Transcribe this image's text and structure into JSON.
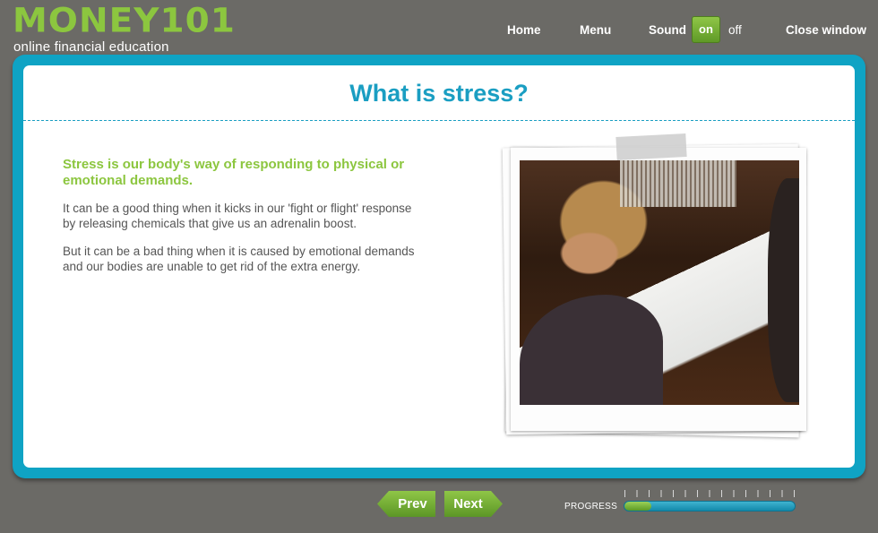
{
  "logo": {
    "brand": "MONEY101",
    "tagline": "online financial education"
  },
  "nav": {
    "home": "Home",
    "menu": "Menu",
    "sound_label": "Sound",
    "sound_on": "on",
    "sound_off": "off",
    "close": "Close window"
  },
  "page": {
    "title": "What is stress?",
    "lead": "Stress is our body's way of responding to physical or emotional demands.",
    "paragraphs": [
      "It can be a good thing when it kicks in our 'fight or flight' response by releasing chemicals that give us an adrenalin boost.",
      "But it can be a bad thing when it is caused by emotional demands and our bodies are unable to get rid of the extra energy."
    ]
  },
  "footer": {
    "prev": "Prev",
    "next": "Next",
    "progress_label": "PROGRESS",
    "progress_fraction": 0.16
  },
  "colors": {
    "accent_green": "#8cc63f",
    "accent_blue": "#1a9ec2",
    "background": "#6b6a66"
  }
}
